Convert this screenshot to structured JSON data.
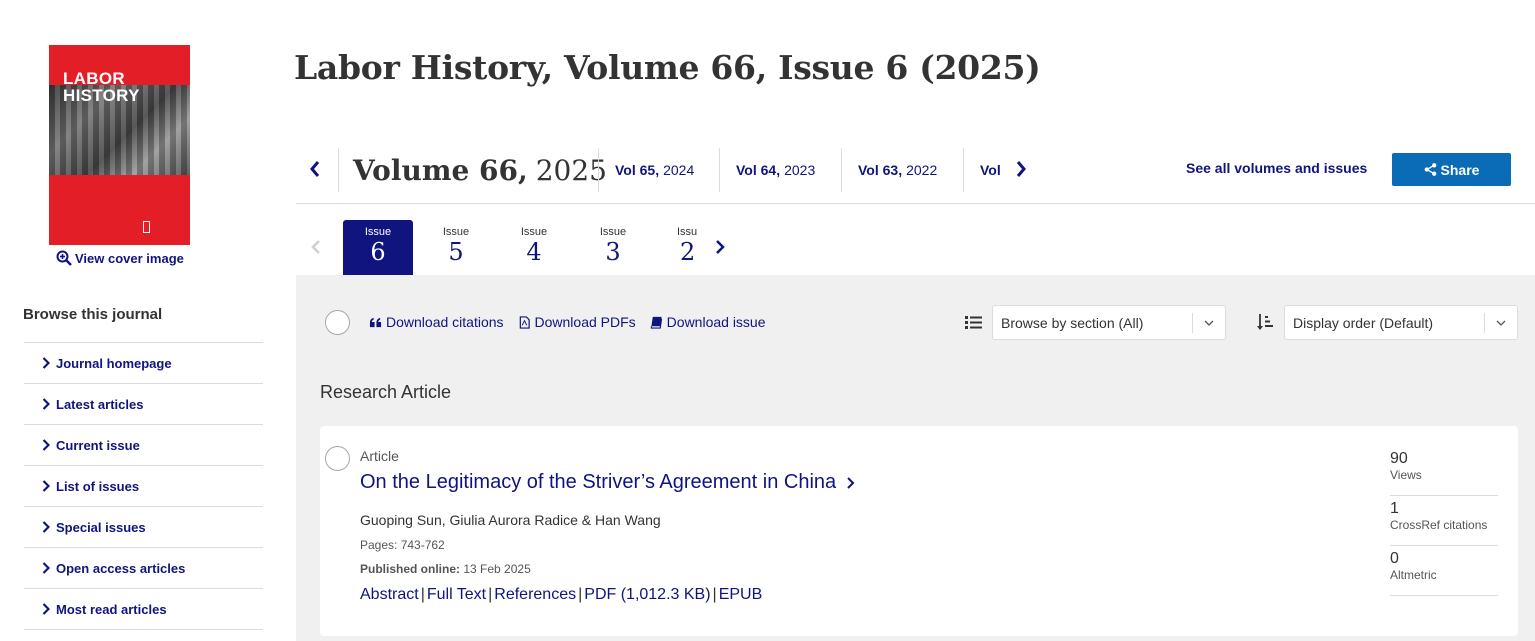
{
  "colors": {
    "navy": "#10147e",
    "share_blue": "#0a6bb6",
    "cover_red": "#e41e26",
    "grey_bg": "#f0f0f0"
  },
  "cover": {
    "title_line1": "LABOR",
    "title_line2": "HISTORY",
    "view_cover_label": "View cover image"
  },
  "sidebar": {
    "heading": "Browse this journal",
    "items": [
      {
        "label": "Journal homepage"
      },
      {
        "label": "Latest articles"
      },
      {
        "label": "Current issue"
      },
      {
        "label": "List of issues"
      },
      {
        "label": "Special issues"
      },
      {
        "label": "Open access articles"
      },
      {
        "label": "Most read articles"
      }
    ]
  },
  "page_title": "Labor History, Volume 66, Issue 6 (2025)",
  "volumes": {
    "current_vol": "Volume 66,",
    "current_year": "2025",
    "others": [
      {
        "vol": "Vol 65,",
        "year": "2024"
      },
      {
        "vol": "Vol 64,",
        "year": "2023"
      },
      {
        "vol": "Vol 63,",
        "year": "2022"
      },
      {
        "vol": "Vol",
        "year": ""
      }
    ],
    "see_all_label": "See all volumes and issues",
    "share_label": "Share"
  },
  "issues": [
    {
      "label": "Issue",
      "number": "6",
      "active": true
    },
    {
      "label": "Issue",
      "number": "5"
    },
    {
      "label": "Issue",
      "number": "4"
    },
    {
      "label": "Issue",
      "number": "3"
    },
    {
      "label": "Issu",
      "number": "2"
    }
  ],
  "toolbar": {
    "download_citations": "Download citations",
    "download_pdfs": "Download PDFs",
    "download_issue": "Download issue",
    "browse_section": "Browse by section (All)",
    "display_order": "Display order (Default)"
  },
  "section_title": "Research Article",
  "article": {
    "type": "Article",
    "title": "On the Legitimacy of the Striver’s Agreement in China",
    "authors": "Guoping Sun, Giulia Aurora Radice & Han Wang",
    "pages": "Pages: 743-762",
    "published_label": "Published online:",
    "published_date": "13 Feb 2025",
    "links": [
      "Abstract",
      "Full Text",
      "References",
      "PDF (1,012.3 KB)",
      "EPUB"
    ],
    "metrics": [
      {
        "value": "90",
        "label": "Views"
      },
      {
        "value": "1",
        "label": "CrossRef citations"
      },
      {
        "value": "0",
        "label": "Altmetric"
      }
    ]
  }
}
